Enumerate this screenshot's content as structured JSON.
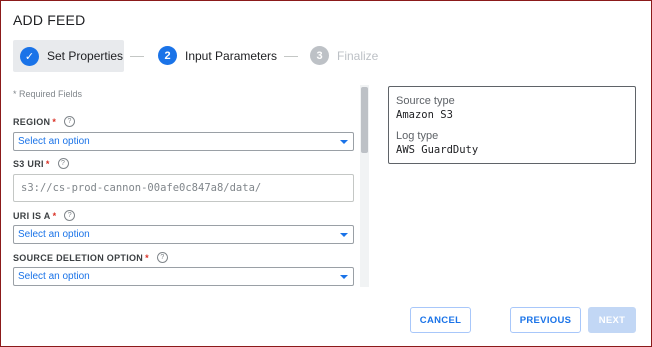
{
  "dialog": {
    "title": "ADD FEED"
  },
  "stepper": {
    "steps": [
      {
        "number": "✓",
        "label": "Set Properties",
        "state": "completed"
      },
      {
        "number": "2",
        "label": "Input Parameters",
        "state": "active"
      },
      {
        "number": "3",
        "label": "Finalize",
        "state": "disabled"
      }
    ]
  },
  "form": {
    "required_note": "* Required Fields",
    "region": {
      "label": "REGION",
      "required_mark": "*",
      "value": "Select an option"
    },
    "s3_uri": {
      "label": "S3 URI",
      "required_mark": "*",
      "placeholder": "s3://cs-prod-cannon-00afe0c847a8/data/"
    },
    "uri_is_a": {
      "label": "URI IS A",
      "required_mark": "*",
      "value": "Select an option"
    },
    "source_deletion": {
      "label": "SOURCE DELETION OPTION",
      "required_mark": "*",
      "value": "Select an option"
    },
    "help_glyph": "?"
  },
  "info_panel": {
    "source_type_label": "Source type",
    "source_type_value": "Amazon S3",
    "log_type_label": "Log type",
    "log_type_value": "AWS GuardDuty"
  },
  "footer": {
    "cancel_label": "CANCEL",
    "previous_label": "PREVIOUS",
    "next_label": "NEXT"
  },
  "colors": {
    "accent": "#1a73e8",
    "required": "#d93025",
    "disabled_button": "#c2d7f5",
    "frame_border": "#8b1a1a"
  }
}
